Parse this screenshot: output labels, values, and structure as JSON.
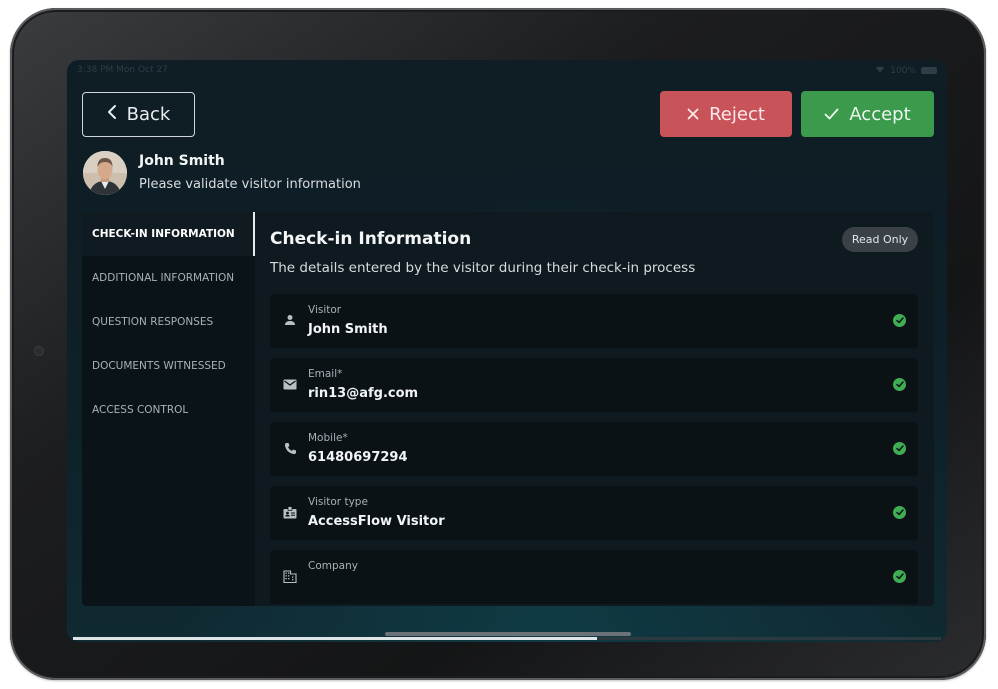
{
  "status_bar": {
    "time": "3:38 PM  Mon Oct 27",
    "battery": "100%"
  },
  "header": {
    "back_label": "Back",
    "reject_label": "Reject",
    "accept_label": "Accept"
  },
  "visitor_header": {
    "name": "John Smith",
    "subtitle": "Please validate visitor information"
  },
  "sidebar": {
    "items": [
      {
        "label": "CHECK-IN INFORMATION",
        "active": true
      },
      {
        "label": "ADDITIONAL INFORMATION",
        "active": false
      },
      {
        "label": "QUESTION RESPONSES",
        "active": false
      },
      {
        "label": "DOCUMENTS WITNESSED",
        "active": false
      },
      {
        "label": "ACCESS CONTROL",
        "active": false
      }
    ]
  },
  "panel": {
    "title": "Check-in Information",
    "description": "The details entered by the visitor during their check-in process",
    "badge": "Read Only",
    "fields": [
      {
        "label": "Visitor",
        "value": "John Smith",
        "icon": "person-icon",
        "valid": true
      },
      {
        "label": "Email*",
        "value": "rin13@afg.com",
        "icon": "mail-icon",
        "valid": true
      },
      {
        "label": "Mobile*",
        "value": "61480697294",
        "icon": "phone-icon",
        "valid": true
      },
      {
        "label": "Visitor type",
        "value": "AccessFlow Visitor",
        "icon": "badge-icon",
        "valid": true
      },
      {
        "label": "Company",
        "value": "",
        "icon": "building-icon",
        "valid": true
      }
    ]
  },
  "colors": {
    "reject": "#c8545a",
    "accept": "#3c9a4c",
    "valid_check": "#3fae52"
  }
}
